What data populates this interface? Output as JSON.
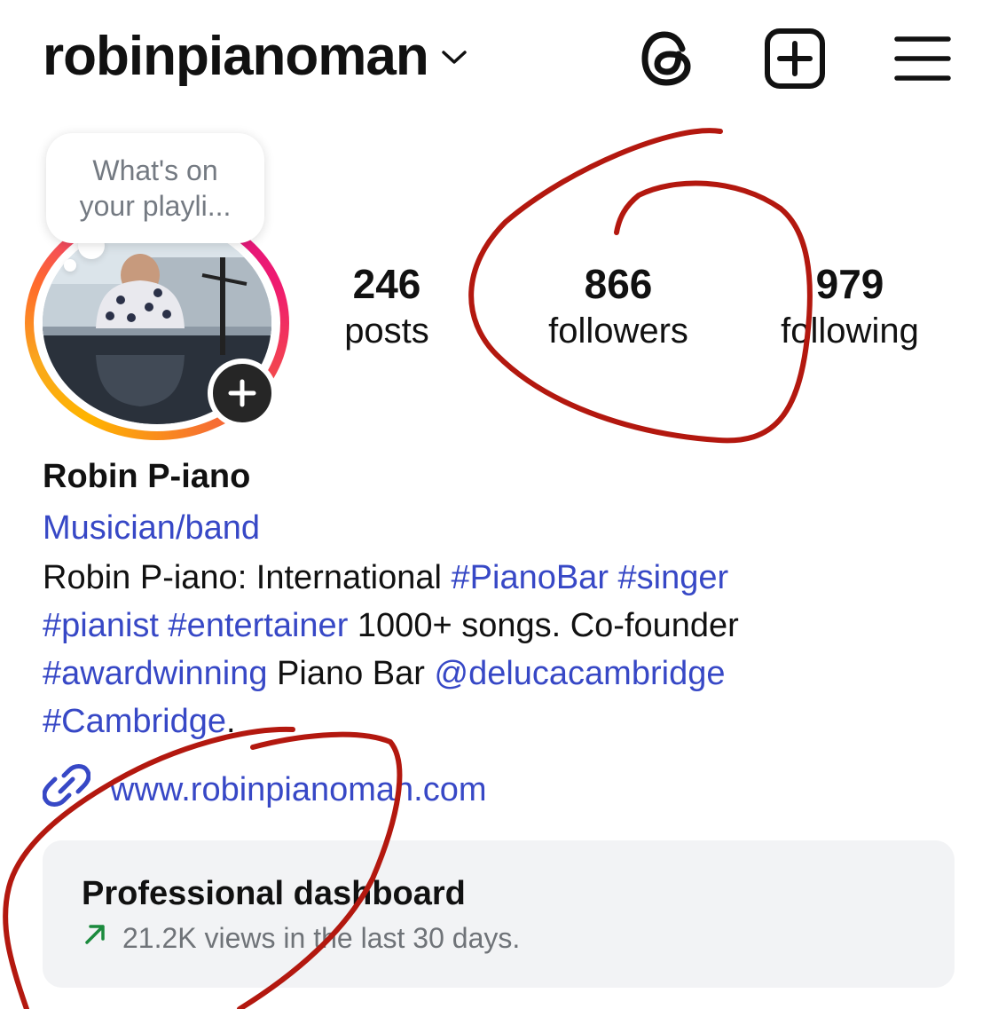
{
  "header": {
    "username": "robinpianoman",
    "icons": [
      "threads-icon",
      "create-post-icon",
      "menu-icon"
    ]
  },
  "profile": {
    "note": {
      "line1": "What's on",
      "line2": "your playli..."
    },
    "stats": {
      "posts": {
        "value": "246",
        "label": "posts"
      },
      "followers": {
        "value": "866",
        "label": "followers"
      },
      "following": {
        "value": "979",
        "label": "following"
      }
    },
    "display_name": "Robin P-iano",
    "category": "Musician/band",
    "bio": {
      "t1": "Robin P-iano: International ",
      "tag_pianobar": "#PianoBar",
      "sp1": " ",
      "tag_singer": "#singer",
      "tag_pianist": "#pianist",
      "sp2": " ",
      "tag_entertainer": "#entertainer",
      "t2": " 1000+ songs. Co-founder ",
      "tag_awardwinning": "#awardwinning",
      "t3": " Piano Bar ",
      "mention": "@delucacambridge",
      "tag_cambridge": "#Cambridge",
      "t4": "."
    },
    "website": "www.robinpianoman.com"
  },
  "dashboard": {
    "title": "Professional dashboard",
    "subtitle": "21.2K views in the last 30 days."
  },
  "colors": {
    "link_blue": "#3748c6",
    "annotation_red": "#b3180f",
    "trend_green": "#1b8a3d",
    "dashboard_bg": "#f2f3f5"
  }
}
